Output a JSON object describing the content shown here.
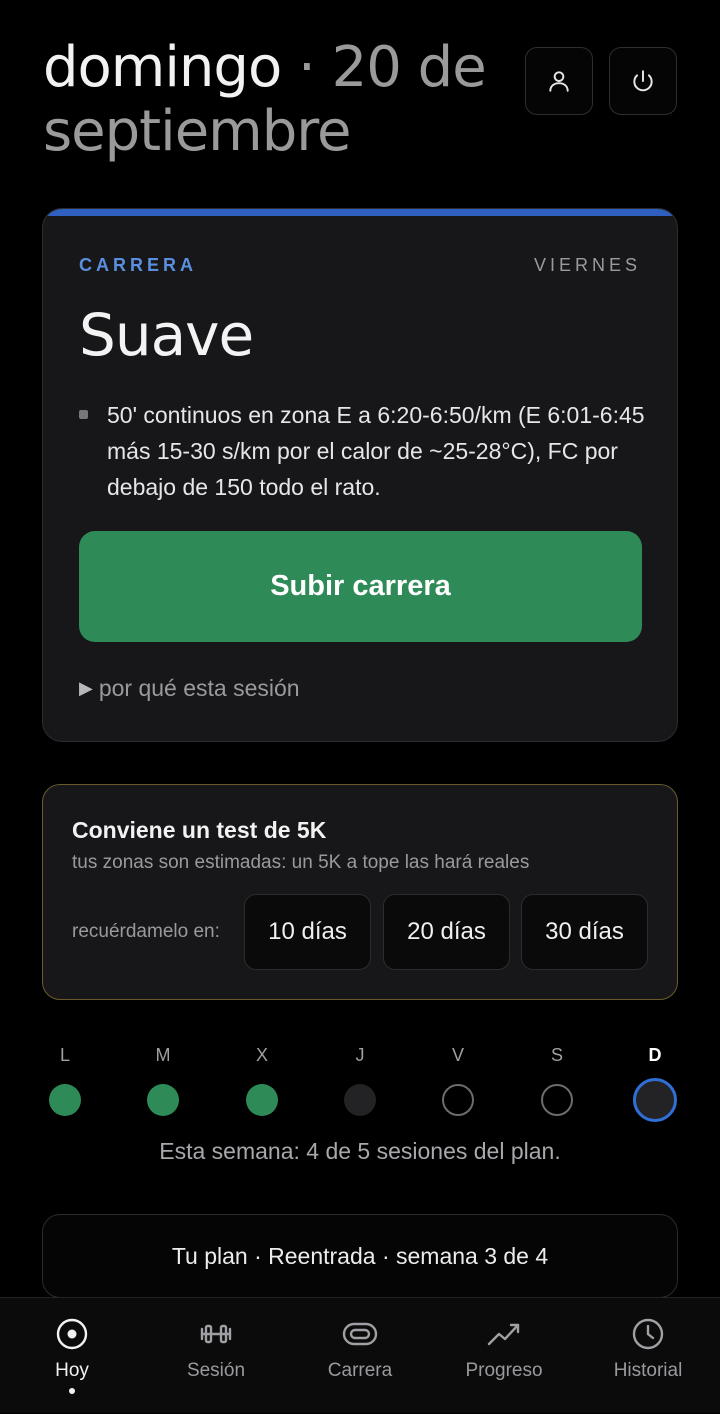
{
  "header": {
    "day": "domingo",
    "separator": " · ",
    "date_rest": "20 de septiembre",
    "profile_icon": "user-icon",
    "power_icon": "power-icon"
  },
  "session_card": {
    "kicker": "CARRERA",
    "day_name": "VIERNES",
    "title": "Suave",
    "bullets": [
      "50' continuos en zona E a 6:20-6:50/km (E 6:01-6:45 más 15-30 s/km por el calor de ~25-28°C), FC por debajo de 150 todo el rato."
    ],
    "primary_button": "Subir carrera",
    "disclosure": "por qué esta sesión",
    "accent_color": "#2f5fbf",
    "button_color": "#2e8b57"
  },
  "test_card": {
    "title": "Conviene un test de 5K",
    "subtitle": "tus zonas son estimadas: un 5K a tope las hará reales",
    "remind_label": "recuérdamelo en:",
    "options": [
      "10 días",
      "20 días",
      "30 días"
    ],
    "border_color": "#6b5a2c"
  },
  "week": {
    "days": [
      {
        "letter": "L",
        "state": "done"
      },
      {
        "letter": "M",
        "state": "done"
      },
      {
        "letter": "X",
        "state": "done"
      },
      {
        "letter": "J",
        "state": "rest"
      },
      {
        "letter": "V",
        "state": "pending"
      },
      {
        "letter": "S",
        "state": "pending"
      },
      {
        "letter": "D",
        "state": "today"
      }
    ],
    "summary": "Esta semana: 4 de 5 sesiones del plan."
  },
  "plan_banner": "Tu plan · Reentrada · semana 3 de 4",
  "nav": {
    "items": [
      {
        "label": "Hoy",
        "icon": "target-icon",
        "active": true
      },
      {
        "label": "Sesión",
        "icon": "dumbbell-icon",
        "active": false
      },
      {
        "label": "Carrera",
        "icon": "track-icon",
        "active": false
      },
      {
        "label": "Progreso",
        "icon": "trend-icon",
        "active": false
      },
      {
        "label": "Historial",
        "icon": "clock-icon",
        "active": false
      }
    ]
  }
}
